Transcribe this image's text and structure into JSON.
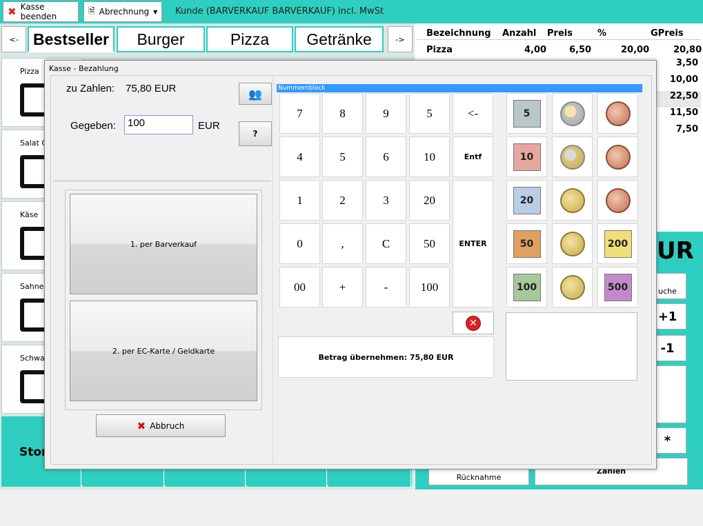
{
  "topbar": {
    "kasse_beenden": "Kasse beenden",
    "abrechnung": "Abrechnung",
    "title": "Kunde (BARVERKAUF BARVERKAUF) incl. MwSt"
  },
  "nav": {
    "prev": "<-",
    "next": "->"
  },
  "categories": [
    "Bestseller",
    "Burger",
    "Pizza",
    "Getränke"
  ],
  "products": [
    "Pizza",
    "Salat C",
    "Käse",
    "Sahne",
    "Schwarz"
  ],
  "storno_label": "Storno",
  "table": {
    "headers": [
      "Bezeichnung",
      "Anzahl",
      "Preis",
      "%",
      "GPreis"
    ],
    "first_row": {
      "bezeichnung": "Pizza",
      "anzahl": "4,00",
      "preis": "6,50",
      "prozent": "20,00",
      "gpreis": "20,80"
    },
    "gpreis_values": [
      "3,50",
      "10,00",
      "22,50",
      "11,50",
      "7,50"
    ]
  },
  "right_panel": {
    "currency": "UR",
    "suche": "uche",
    "plus_one": "+1",
    "minus_one": "-1",
    "star": "*",
    "ruecknahme": "Rücknahme",
    "zahlen": "Zahlen"
  },
  "dialog": {
    "title": "Kasse - Bezahlung",
    "zu_zahlen_label": "zu Zahlen:",
    "zu_zahlen_value": "75,80 EUR",
    "gegeben_label": "Gegeben:",
    "gegeben_value": "100",
    "currency": "EUR",
    "pay_option_1": "1. per Barverkauf",
    "pay_option_2": "2. per EC-Karte / Geldkarte",
    "abbruch": "Abbruch",
    "numblock_title": "Nummernblock",
    "keys": [
      [
        "7",
        "8",
        "9",
        "5",
        "<-"
      ],
      [
        "4",
        "5",
        "6",
        "10",
        "Entf"
      ],
      [
        "1",
        "2",
        "3",
        "20",
        ""
      ],
      [
        "0",
        ",",
        "C",
        "50",
        "ENTER"
      ],
      [
        "00",
        "+",
        "-",
        "100",
        ""
      ]
    ],
    "betrag_label": "Betrag übernehmen:",
    "betrag_value": "75,80 EUR",
    "notes": [
      "5",
      "10",
      "20",
      "50",
      "100",
      "200",
      "500"
    ],
    "coin_labels": [
      "1 €",
      "2 €",
      "50 c",
      "20 c",
      "10 c",
      "5 c",
      "2 c",
      "1 c"
    ]
  },
  "colors": {
    "accent": "#2ecfc0",
    "selection": "#3399ff",
    "cancel": "#dd2222"
  }
}
